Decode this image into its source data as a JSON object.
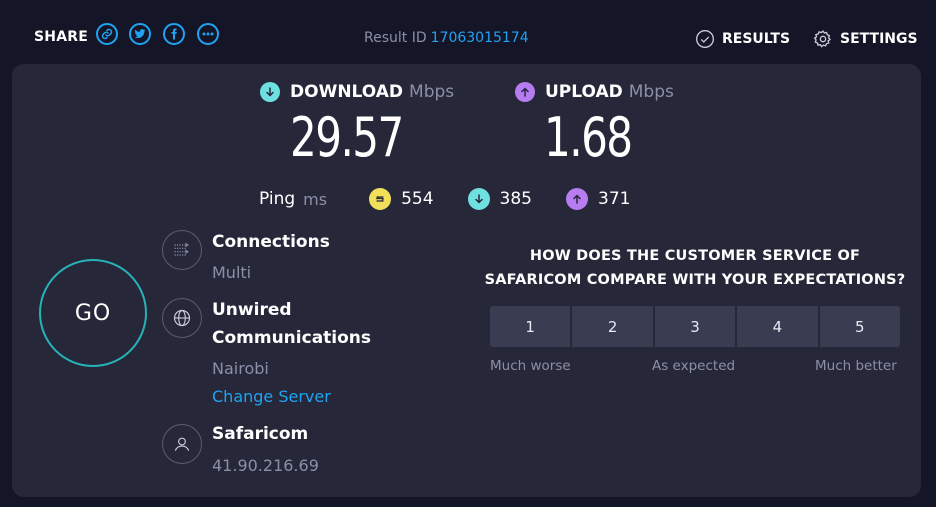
{
  "header": {
    "share_label": "SHARE",
    "share_icons": [
      "link-icon",
      "twitter-icon",
      "facebook-icon",
      "more-icon"
    ],
    "result_label": "Result ID",
    "result_id": "17063015174",
    "results_label": "RESULTS",
    "settings_label": "SETTINGS"
  },
  "download": {
    "label": "DOWNLOAD",
    "unit": "Mbps",
    "value": "29.57"
  },
  "upload": {
    "label": "UPLOAD",
    "unit": "Mbps",
    "value": "1.68"
  },
  "ping": {
    "label": "Ping",
    "unit": "ms",
    "idle": "554",
    "download": "385",
    "upload": "371"
  },
  "go_label": "GO",
  "connections": {
    "title": "Connections",
    "value": "Multi"
  },
  "server": {
    "name_line1": "Unwired",
    "name_line2": "Communications",
    "location": "Nairobi",
    "change_label": "Change Server"
  },
  "provider": {
    "name": "Safaricom",
    "ip": "41.90.216.69"
  },
  "survey": {
    "question_line1": "HOW DOES THE CUSTOMER SERVICE OF",
    "question_line2": "SAFARICOM COMPARE WITH YOUR EXPECTATIONS?",
    "options": [
      "1",
      "2",
      "3",
      "4",
      "5"
    ],
    "low_label": "Much worse",
    "mid_label": "As expected",
    "high_label": "Much better"
  },
  "colors": {
    "accent_blue": "#1fa3f2",
    "download_teal": "#6ee0e0",
    "upload_purple": "#b77cf2",
    "ping_yellow": "#f2e05a",
    "go_ring": "#27b3b8"
  }
}
